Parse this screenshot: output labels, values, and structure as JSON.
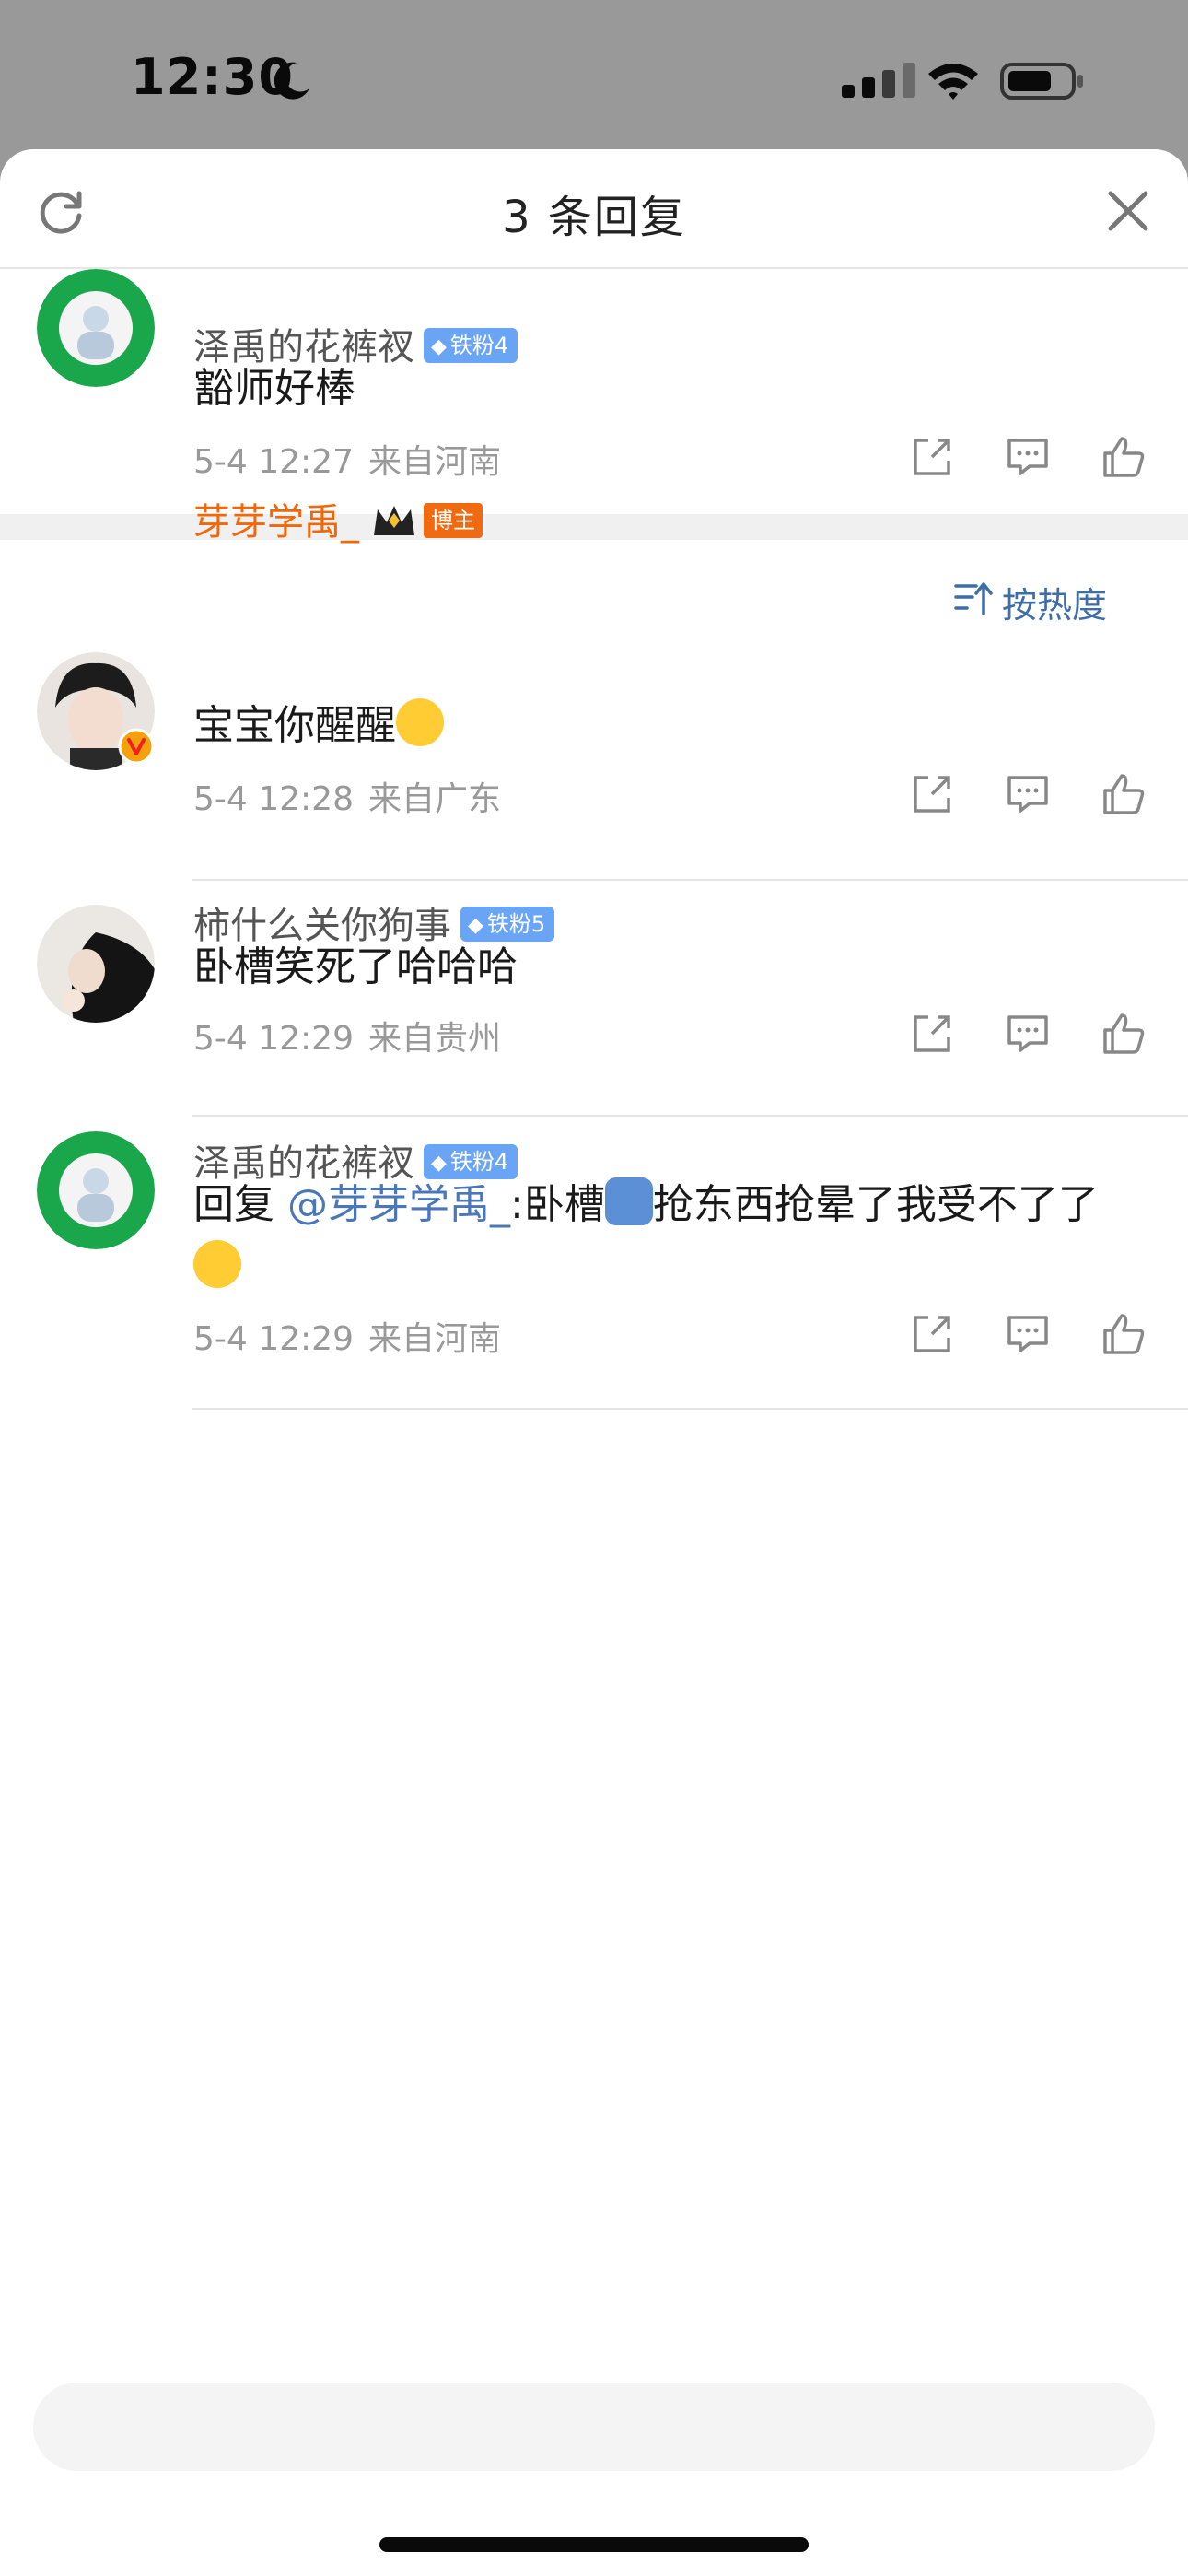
{
  "status_bar": {
    "time": "12:30"
  },
  "header": {
    "title": "3 条回复"
  },
  "root_comment": {
    "username": "泽禹的花裤衩",
    "badge": "铁粉4",
    "text": "豁师好棒",
    "date": "5-4 12:27",
    "location": "来自河南"
  },
  "sort": {
    "label": "按热度"
  },
  "replies": [
    {
      "username": "芽芽学禹_",
      "badge": "博主",
      "text": "宝宝你醒醒",
      "date": "5-4 12:28",
      "location": "来自广东"
    },
    {
      "username": "柿什么关你狗事",
      "badge": "铁粉5",
      "text": "卧槽笑死了哈哈哈",
      "date": "5-4 12:29",
      "location": "来自贵州"
    },
    {
      "username": "泽禹的花裤衩",
      "badge": "铁粉4",
      "reply_prefix": "回复 ",
      "mention": "@芽芽学禹_",
      "text_a": ":卧槽",
      "text_b": "抢东西抢晕了我受不了了",
      "date": "5-4 12:29",
      "location": "来自河南"
    }
  ],
  "icons": {
    "refresh": "refresh-icon",
    "close": "close-icon",
    "share": "share-icon",
    "comment": "comment-icon",
    "like": "like-icon",
    "sort": "sort-icon"
  },
  "colors": {
    "accent": "#4a77b7",
    "host_name": "#f0680a",
    "fan_badge": "#6aa5f5",
    "host_badge": "#f06a12"
  }
}
